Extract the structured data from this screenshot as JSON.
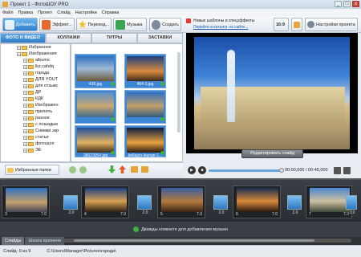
{
  "window": {
    "title": "Проект 1 - ФотоШОУ PRO",
    "min": "_",
    "max": "□",
    "close": "x"
  },
  "menu": [
    "Файл",
    "Правка",
    "Проект",
    "Слайд",
    "Настройки",
    "Справка"
  ],
  "toolbar": {
    "add": "Добавить",
    "effects": "Эффект...",
    "transitions": "Переход...",
    "music": "Музыка",
    "create": "Создать",
    "news1": "Новые шаблоны и спецэффекты",
    "news2": "Перейти в каталог на сайте...",
    "ratio": "16:9",
    "settings": "Настройки проекта"
  },
  "tabs": [
    "ФОТО И ВИДЕО",
    "КОЛЛАЖИ",
    "ТИТРЫ",
    "ЗАСТАВКИ"
  ],
  "tree": [
    {
      "label": "Избранное",
      "level": 1
    },
    {
      "label": "Изображения",
      "level": 1
    },
    {
      "label": "albums",
      "level": 2
    },
    {
      "label": "lkz.cahdq",
      "level": 2
    },
    {
      "label": "города",
      "level": 2
    },
    {
      "label": "ДЛЯ YOUT",
      "level": 2
    },
    {
      "label": "для отзывс",
      "level": 2
    },
    {
      "label": "ДР",
      "level": 2
    },
    {
      "label": "КДК",
      "level": 2
    },
    {
      "label": "Изображен",
      "level": 2
    },
    {
      "label": "прилепь",
      "level": 2
    },
    {
      "label": "разное",
      "level": 2
    },
    {
      "label": "с лошадьм",
      "level": 2
    },
    {
      "label": "Снимки экр",
      "level": 2
    },
    {
      "label": "статьи",
      "level": 2
    },
    {
      "label": "фотошоп",
      "level": 2
    },
    {
      "label": "ЭЕ",
      "level": 2
    }
  ],
  "thumbnails": [
    {
      "label": "438.jpg"
    },
    {
      "label": "464-3.jpg"
    },
    {
      "label": ""
    },
    {
      "label": ""
    },
    {
      "label": "38023054.jpg"
    },
    {
      "label": "bellagio-lounge-1..."
    },
    {
      "label": ""
    },
    {
      "label": ""
    }
  ],
  "left_bottom": {
    "favorites": "Избранные папки"
  },
  "preview": {
    "edit": "Редактировать слайд",
    "time": "00:00,000 / 00:45,000"
  },
  "slides": [
    {
      "n": "3",
      "d": "7.0"
    },
    {
      "n": "4",
      "d": "7.0"
    },
    {
      "n": "5",
      "d": "7.0"
    },
    {
      "n": "6",
      "d": "7.0"
    },
    {
      "n": "7",
      "d": "7.0"
    }
  ],
  "transitions": [
    "2.0",
    "2.0",
    "2.0",
    "2.0",
    "2.0"
  ],
  "music_hint": "Дважды кликните для добавления музыки",
  "bottom_tabs": [
    "Слайды",
    "Шкала времени"
  ],
  "status": {
    "slide": "Слайд: 9 из 9",
    "path": "C:\\Users\\Manager\\Pictures\\города\\"
  }
}
